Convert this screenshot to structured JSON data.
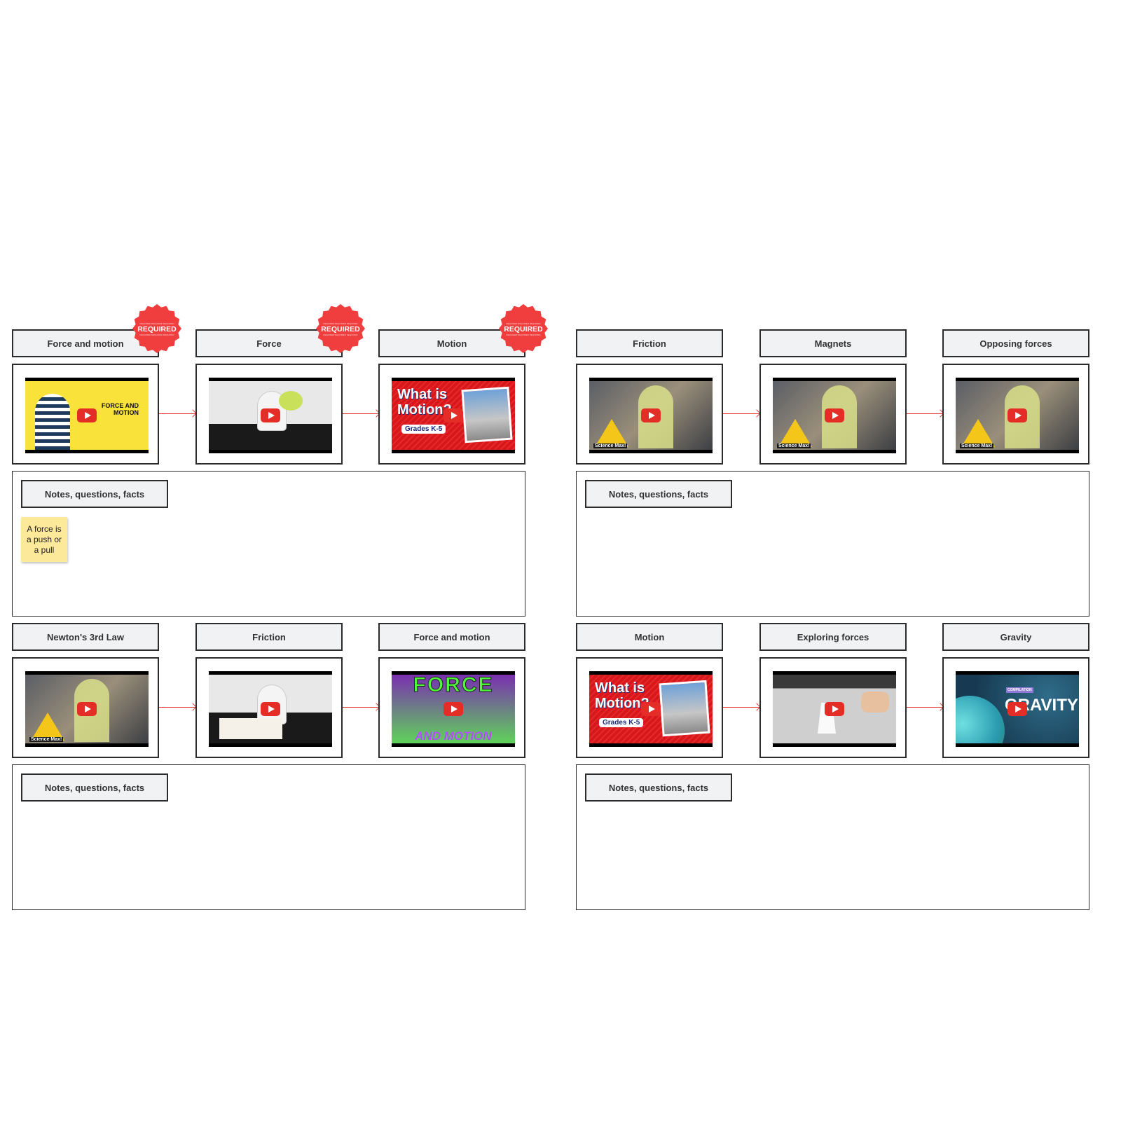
{
  "board": {
    "groups": [
      {
        "videos": [
          {
            "title": "Force and motion",
            "required": true,
            "thumb": {
              "style": "yellow",
              "text": "FORCE AND MOTION"
            }
          },
          {
            "title": "Force",
            "required": true,
            "thumb": {
              "style": "lab-balloon",
              "text": ""
            }
          },
          {
            "title": "Motion",
            "required": true,
            "thumb": {
              "style": "red-train",
              "text": "What is Motion?",
              "subtext": "Grades K-5"
            }
          }
        ],
        "notes_title": "Notes, questions, facts",
        "stickies": [
          "A force is a push or a pull"
        ]
      },
      {
        "videos": [
          {
            "title": "Friction",
            "required": false,
            "thumb": {
              "style": "science-max",
              "text": "Science Max!"
            }
          },
          {
            "title": "Magnets",
            "required": false,
            "thumb": {
              "style": "science-max",
              "text": "Science Max!"
            }
          },
          {
            "title": "Opposing forces",
            "required": false,
            "thumb": {
              "style": "science-max",
              "text": "Science Max!"
            }
          }
        ],
        "notes_title": "Notes, questions, facts",
        "stickies": []
      },
      {
        "videos": [
          {
            "title": "Newton's 3rd Law",
            "required": false,
            "thumb": {
              "style": "science-max",
              "text": "Science Max!"
            }
          },
          {
            "title": "Friction",
            "required": false,
            "thumb": {
              "style": "lab-table",
              "text": ""
            }
          },
          {
            "title": "Force and motion",
            "required": false,
            "thumb": {
              "style": "green-purple",
              "text": "FORCE",
              "subtext": "AND MOTION"
            }
          }
        ],
        "notes_title": "Notes, questions, facts",
        "stickies": []
      },
      {
        "videos": [
          {
            "title": "Motion",
            "required": false,
            "thumb": {
              "style": "red-train",
              "text": "What is Motion?",
              "subtext": "Grades K-5"
            }
          },
          {
            "title": "Exploring forces",
            "required": false,
            "thumb": {
              "style": "cup-experiment",
              "text": ""
            }
          },
          {
            "title": "Gravity",
            "required": false,
            "thumb": {
              "style": "space",
              "text": "GRAVITY",
              "subtext": "COMPILATION"
            }
          }
        ],
        "notes_title": "Notes, questions, facts",
        "stickies": []
      }
    ],
    "badge_label": "REQUIRED",
    "badge_small_text": "REQUIRED REQUIRED REQUIRED",
    "colors": {
      "badge": "#f03e3e",
      "arrow": "#e53935",
      "sticky": "#fde99a",
      "title_bg": "#f1f2f4"
    }
  }
}
